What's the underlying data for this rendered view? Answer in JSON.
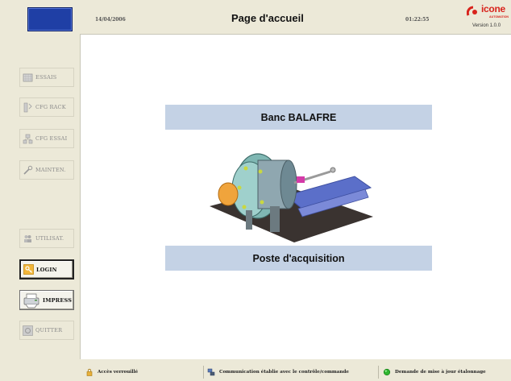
{
  "header": {
    "date": "14/04/2006",
    "title": "Page d'accueil",
    "time": "01:22:55",
    "brand_name": "icone",
    "brand_sub": "AUTOMATION",
    "version": "Version 1.0.0"
  },
  "sidebar": {
    "items": [
      {
        "label": "ESSAIS",
        "icon": "chart-grid-icon",
        "enabled": false
      },
      {
        "label": "CFG RACK",
        "icon": "rack-tools-icon",
        "enabled": false
      },
      {
        "label": "CFG ESSAI",
        "icon": "network-config-icon",
        "enabled": false
      },
      {
        "label": "MAINTEN.",
        "icon": "wrench-icon",
        "enabled": false
      },
      {
        "label": "UTILISAT.",
        "icon": "users-icon",
        "enabled": false
      },
      {
        "label": "LOGIN",
        "icon": "key-icon",
        "enabled": true
      },
      {
        "label": "IMPRESS",
        "icon": "printer-icon",
        "enabled": true
      },
      {
        "label": "QUITTER",
        "icon": "exit-icon",
        "enabled": false
      }
    ]
  },
  "main": {
    "banner_top": "Banc BALAFRE",
    "banner_bottom": "Poste d'acquisition"
  },
  "status": {
    "access": "Accès verrouillé",
    "communication": "Communication établie avec le contrôle/commande",
    "calibration": "Demande de mise à jour étalonnage"
  },
  "colors": {
    "accent_blue": "#1f3fa5",
    "banner": "#c4d2e5",
    "brand_red": "#d8231c",
    "status_ok": "#2fb52f"
  }
}
